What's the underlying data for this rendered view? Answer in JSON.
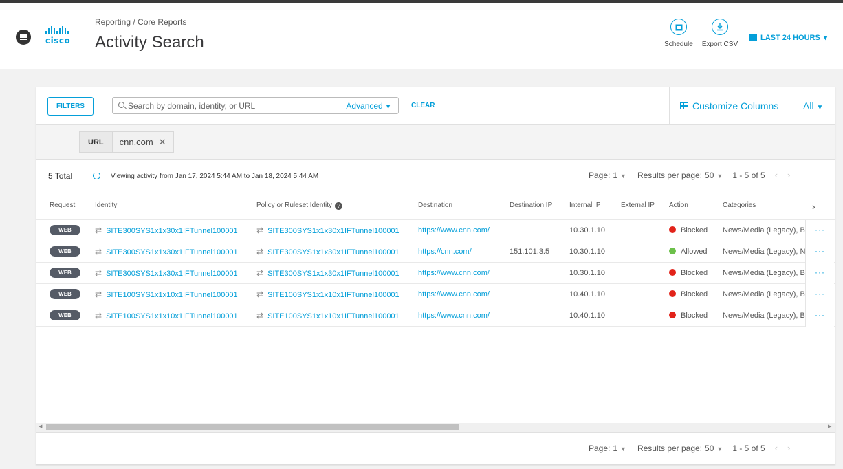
{
  "header": {
    "breadcrumb": "Reporting / Core Reports",
    "title": "Activity Search",
    "logo_text": "cisco",
    "schedule_label": "Schedule",
    "export_label": "Export CSV",
    "time_range": "LAST 24 HOURS"
  },
  "filterbar": {
    "filters_label": "FILTERS",
    "search_placeholder": "Search by domain, identity, or URL",
    "advanced_label": "Advanced",
    "clear_label": "CLEAR",
    "customize_label": "Customize Columns",
    "all_label": "All"
  },
  "chip": {
    "key": "URL",
    "value": "cnn.com"
  },
  "info": {
    "total": "5 Total",
    "viewing": "Viewing activity from Jan 17, 2024 5:44 AM to Jan 18, 2024 5:44 AM",
    "page_label": "Page:",
    "page_value": "1",
    "rpp_label": "Results per page:",
    "rpp_value": "50",
    "range": "1 - 5 of 5"
  },
  "columns": [
    "Request",
    "Identity",
    "Policy or Ruleset Identity",
    "Destination",
    "Destination IP",
    "Internal IP",
    "External IP",
    "Action",
    "Categories"
  ],
  "rows": [
    {
      "request": "WEB",
      "identity": "SITE300SYS1x1x30x1IFTunnel100001",
      "policy": "SITE300SYS1x1x30x1IFTunnel100001",
      "destination": "https://www.cnn.com/",
      "dest_ip": "",
      "internal_ip": "10.30.1.10",
      "external_ip": "",
      "action": "Blocked",
      "categories": "News/Media (Legacy), Bl"
    },
    {
      "request": "WEB",
      "identity": "SITE300SYS1x1x30x1IFTunnel100001",
      "policy": "SITE300SYS1x1x30x1IFTunnel100001",
      "destination": "https://cnn.com/",
      "dest_ip": "151.101.3.5",
      "internal_ip": "10.30.1.10",
      "external_ip": "",
      "action": "Allowed",
      "categories": "News/Media (Legacy), Ne"
    },
    {
      "request": "WEB",
      "identity": "SITE300SYS1x1x30x1IFTunnel100001",
      "policy": "SITE300SYS1x1x30x1IFTunnel100001",
      "destination": "https://www.cnn.com/",
      "dest_ip": "",
      "internal_ip": "10.30.1.10",
      "external_ip": "",
      "action": "Blocked",
      "categories": "News/Media (Legacy), Bl"
    },
    {
      "request": "WEB",
      "identity": "SITE100SYS1x1x10x1IFTunnel100001",
      "policy": "SITE100SYS1x1x10x1IFTunnel100001",
      "destination": "https://www.cnn.com/",
      "dest_ip": "",
      "internal_ip": "10.40.1.10",
      "external_ip": "",
      "action": "Blocked",
      "categories": "News/Media (Legacy), Bl"
    },
    {
      "request": "WEB",
      "identity": "SITE100SYS1x1x10x1IFTunnel100001",
      "policy": "SITE100SYS1x1x10x1IFTunnel100001",
      "destination": "https://www.cnn.com/",
      "dest_ip": "",
      "internal_ip": "10.40.1.10",
      "external_ip": "",
      "action": "Blocked",
      "categories": "News/Media (Legacy), Bl"
    }
  ],
  "colors": {
    "accent": "#049fd9",
    "blocked": "#e2231a",
    "allowed": "#6cc04a"
  },
  "icons": {
    "menu": "hamburger-icon",
    "schedule": "calendar-icon",
    "export": "download-icon",
    "search": "search-icon",
    "refresh": "refresh-icon",
    "tunnel": "tunnel-arrows-icon"
  }
}
